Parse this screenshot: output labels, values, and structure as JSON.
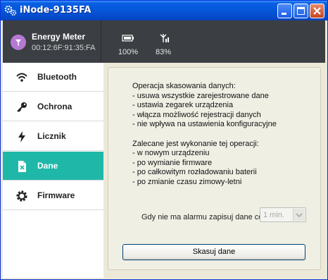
{
  "window": {
    "title": "iNode-9135FA"
  },
  "device": {
    "name": "Energy Meter",
    "id": "00:12:6F:91:35:FA"
  },
  "stats": {
    "battery": "100%",
    "signal": "83%"
  },
  "nav": [
    {
      "label": "Bluetooth",
      "icon": "wifi-icon",
      "active": false
    },
    {
      "label": "Ochrona",
      "icon": "key-icon",
      "active": false
    },
    {
      "label": "Licznik",
      "icon": "lightning-icon",
      "active": false
    },
    {
      "label": "Dane",
      "icon": "file-delete-icon",
      "active": true
    },
    {
      "label": "Firmware",
      "icon": "gear-icon",
      "active": false
    }
  ],
  "info": {
    "title1": "Operacja skasowania danych:",
    "list1": [
      "- usuwa wszystkie zarejestrowane dane",
      "- ustawia zegarek urządzenia",
      "- włącza możliwość rejestracji danych",
      "- nie wpływa na ustawienia konfiguracyjne"
    ],
    "title2": "Zalecane jest wykonanie tej operacji:",
    "list2": [
      "- w nowym urządzeniu",
      "- po wymianie firmware",
      "- po całkowitym rozładowaniu baterii",
      "- po zmianie czasu zimowy-letni"
    ]
  },
  "alarm": {
    "label": "Gdy nie ma alarmu zapisuj dane co",
    "value": "1 min."
  },
  "button": {
    "label": "Skasuj dane"
  },
  "colors": {
    "accent": "#1fb8a8",
    "header": "#3b3e42",
    "device_icon": "#b47ad3"
  }
}
